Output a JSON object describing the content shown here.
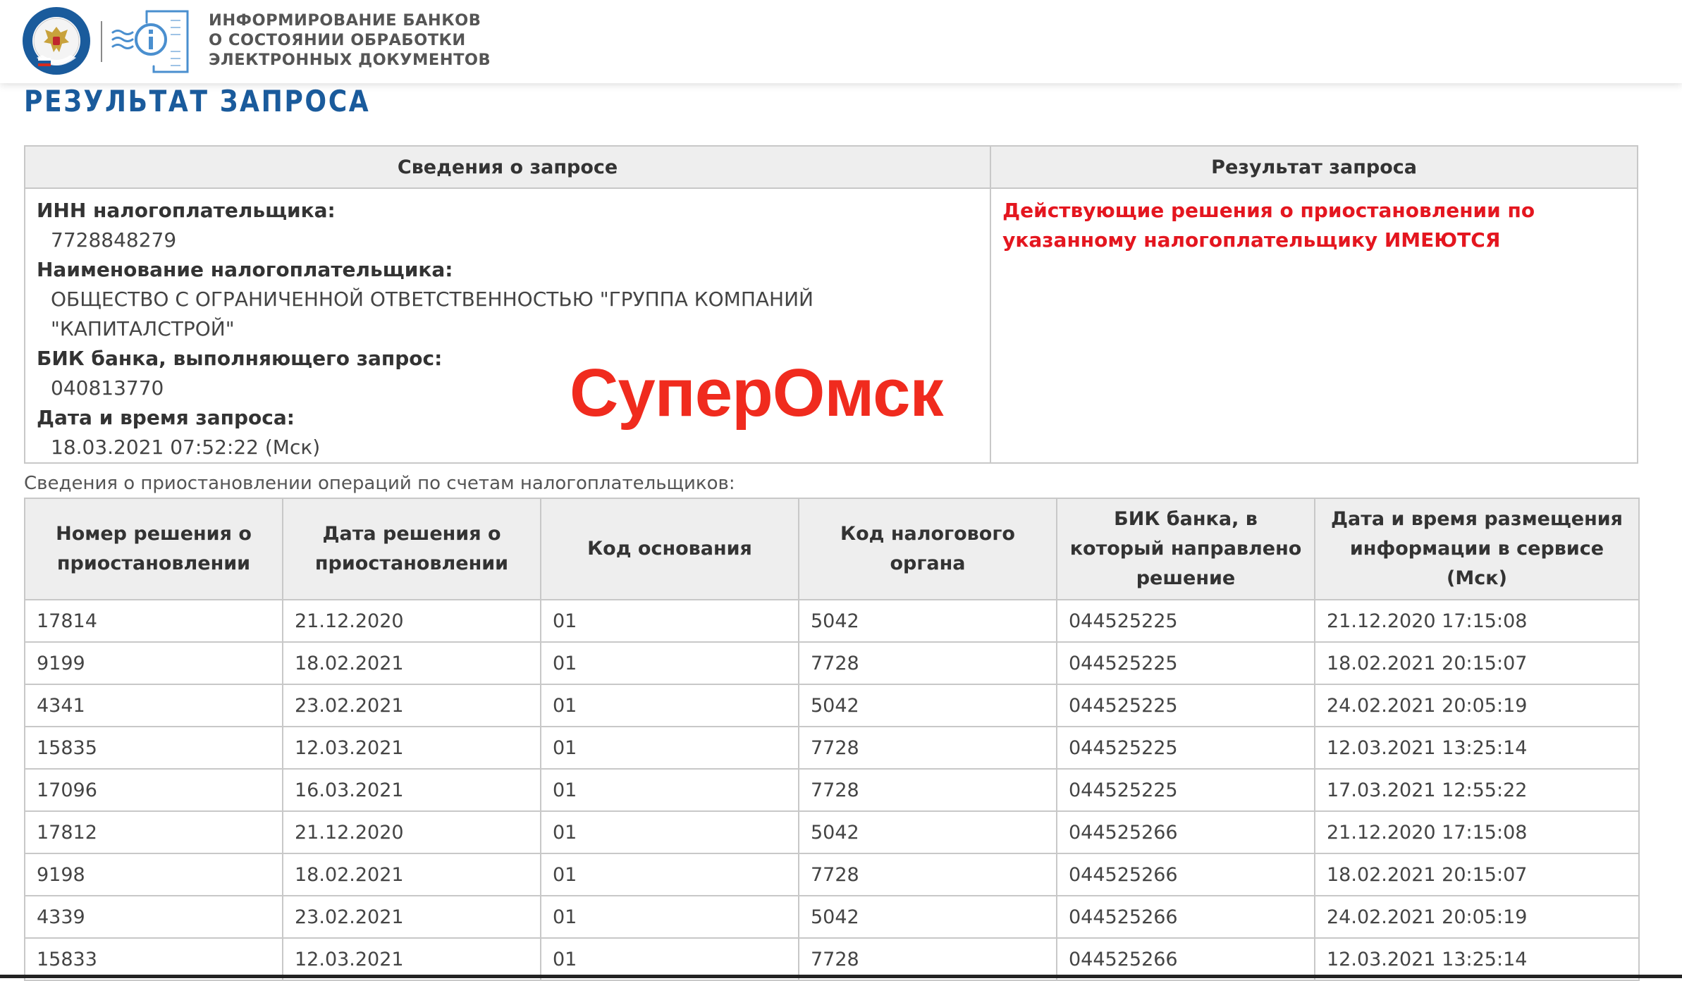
{
  "header": {
    "service_title_lines": [
      "ИНФОРМИРОВАНИЕ БАНКОВ",
      "О СОСТОЯНИИ ОБРАБОТКИ",
      "ЭЛЕКТРОННЫХ ДОКУМЕНТОВ"
    ],
    "fns_logo_icon": "fns-emblem-icon",
    "service_logo_icon": "document-info-icon"
  },
  "page_title": "РЕЗУЛЬТАТ ЗАПРОСА",
  "request_info": {
    "header_left": "Сведения о запросе",
    "header_right": "Результат запроса",
    "fields": [
      {
        "label": "ИНН налогоплательщика:",
        "value": "7728848279"
      },
      {
        "label": "Наименование налогоплательщика:",
        "value": "ОБЩЕСТВО С ОГРАНИЧЕННОЙ ОТВЕТСТВЕННОСТЬЮ \"ГРУППА КОМПАНИЙ \"КАПИТАЛСТРОЙ\""
      },
      {
        "label": "БИК банка, выполняющего запрос:",
        "value": "040813770"
      },
      {
        "label": "Дата и время запроса:",
        "value": "18.03.2021 07:52:22 (Мск)"
      }
    ],
    "result_text": "Действующие решения о приостановлении по указанному налогоплательщику ИМЕЮТСЯ"
  },
  "watermark": "СуперОмск",
  "suspensions": {
    "caption": "Сведения о приостановлении операций по счетам налогоплательщиков:",
    "columns": [
      "Номер решения о приостановлении",
      "Дата решения о приостановлении",
      "Код основания",
      "Код налогового органа",
      "БИК банка, в который направлено решение",
      "Дата и время размещения информации в сервисе (Мск)"
    ],
    "rows": [
      [
        "17814",
        "21.12.2020",
        "01",
        "5042",
        "044525225",
        "21.12.2020 17:15:08"
      ],
      [
        "9199",
        "18.02.2021",
        "01",
        "7728",
        "044525225",
        "18.02.2021 20:15:07"
      ],
      [
        "4341",
        "23.02.2021",
        "01",
        "5042",
        "044525225",
        "24.02.2021 20:05:19"
      ],
      [
        "15835",
        "12.03.2021",
        "01",
        "7728",
        "044525225",
        "12.03.2021 13:25:14"
      ],
      [
        "17096",
        "16.03.2021",
        "01",
        "7728",
        "044525225",
        "17.03.2021 12:55:22"
      ],
      [
        "17812",
        "21.12.2020",
        "01",
        "5042",
        "044525266",
        "21.12.2020 17:15:08"
      ],
      [
        "9198",
        "18.02.2021",
        "01",
        "7728",
        "044525266",
        "18.02.2021 20:15:07"
      ],
      [
        "4339",
        "23.02.2021",
        "01",
        "5042",
        "044525266",
        "24.02.2021 20:05:19"
      ],
      [
        "15833",
        "12.03.2021",
        "01",
        "7728",
        "044525266",
        "12.03.2021 13:25:14"
      ]
    ]
  },
  "colors": {
    "title_blue": "#1a5b9c",
    "result_red": "#e4161f",
    "watermark_red": "#f02b1e",
    "header_gray": "#eeeeee",
    "border_gray": "#c8c8c8"
  }
}
